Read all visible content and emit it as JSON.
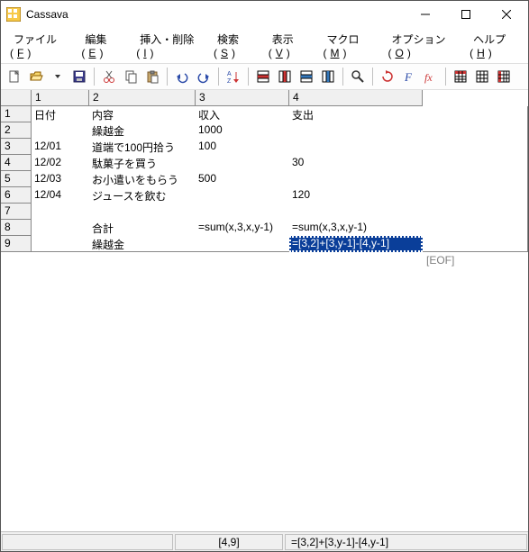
{
  "window": {
    "title": "Cassava"
  },
  "menu": {
    "file": "ファイル(",
    "file_u": "F",
    "file_end": ")",
    "edit": "編集(",
    "edit_u": "E",
    "edit_end": ")",
    "insdel": "挿入・削除(",
    "insdel_u": "I",
    "insdel_end": ")",
    "search": "検索(",
    "search_u": "S",
    "search_end": ")",
    "view": "表示(",
    "view_u": "V",
    "view_end": ")",
    "macro": "マクロ(",
    "macro_u": "M",
    "macro_end": ")",
    "option": "オプション(",
    "option_u": "O",
    "option_end": ")",
    "help": "ヘルプ(",
    "help_u": "H",
    "help_end": ")"
  },
  "colw": {
    "c1": 64,
    "c2": 118,
    "c3": 104,
    "c4": 148
  },
  "headers": {
    "c1": "1",
    "c2": "2",
    "c3": "3",
    "c4": "4"
  },
  "rows": {
    "r1": "1",
    "r2": "2",
    "r3": "3",
    "r4": "4",
    "r5": "5",
    "r6": "6",
    "r7": "7",
    "r8": "8",
    "r9": "9"
  },
  "data": {
    "r1c1": "日付",
    "r1c2": "内容",
    "r1c3": "収入",
    "r1c4": "支出",
    "r2c1": "",
    "r2c2": "繰越金",
    "r2c3": "1000",
    "r2c4": "",
    "r3c1": "12/01",
    "r3c2": "道端で100円拾う",
    "r3c3": "100",
    "r3c4": "",
    "r4c1": "12/02",
    "r4c2": "駄菓子を買う",
    "r4c3": "",
    "r4c4": "30",
    "r5c1": "12/03",
    "r5c2": "お小遣いをもらう",
    "r5c3": "500",
    "r5c4": "",
    "r6c1": "12/04",
    "r6c2": "ジュースを飲む",
    "r6c3": "",
    "r6c4": "120",
    "r7c1": "",
    "r7c2": "",
    "r7c3": "",
    "r7c4": "",
    "r8c1": "",
    "r8c2": "合計",
    "r8c3": "=sum(x,3,x,y-1)",
    "r8c4": "=sum(x,3,x,y-1)",
    "r9c1": "",
    "r9c2": "繰越金",
    "r9c3": "",
    "r9c4": "=[3,2]+[3,y-1]-[4,y-1]"
  },
  "eof": "[EOF]",
  "status": {
    "pos": "[4,9]",
    "formula": "=[3,2]+[3,y-1]-[4,y-1]"
  }
}
